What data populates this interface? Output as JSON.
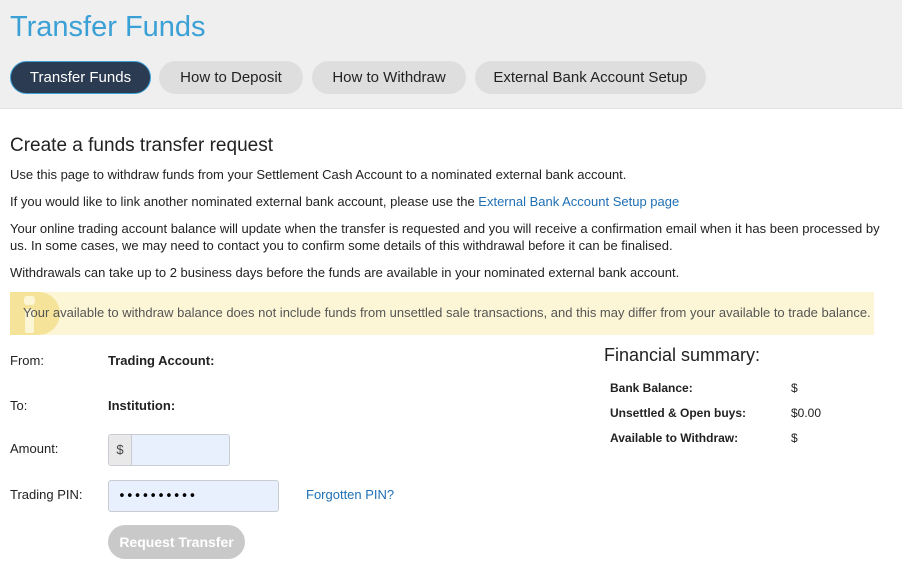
{
  "header": {
    "title": "Transfer Funds",
    "tabs": [
      {
        "label": "Transfer Funds",
        "active": true
      },
      {
        "label": "How to Deposit",
        "active": false
      },
      {
        "label": "How to Withdraw",
        "active": false
      },
      {
        "label": "External Bank Account Setup",
        "active": false
      }
    ]
  },
  "main": {
    "section_title": "Create a funds transfer request",
    "intro": "Use this page to withdraw funds from your Settlement Cash Account to a nominated external bank account.",
    "link_prefix": "If you would like to link another nominated external bank account, please use the ",
    "link_text": "External Bank Account Setup page",
    "balance_note": "Your online trading account balance will update when the transfer is requested and you will receive a confirmation email when it has been processed by us. In some cases, we may need to contact you to confirm some details of this withdrawal before it can be finalised.",
    "timing_note": "Withdrawals can take up to 2 business days before the funds are available in your nominated external bank account.",
    "notice": {
      "icon": "info-icon",
      "text": "Your available to withdraw balance does not include funds from unsettled sale transactions, and this may differ from your available to trade balance."
    }
  },
  "form": {
    "from_label": "From:",
    "from_value": "Trading Account:",
    "to_label": "To:",
    "to_value": "Institution:",
    "amount_label": "Amount:",
    "amount_prefix": "$",
    "amount_value": "",
    "pin_label": "Trading PIN:",
    "pin_value": "••••••••••",
    "forgot_pin": "Forgotten PIN?",
    "submit_label": "Request Transfer"
  },
  "summary": {
    "title": "Financial summary:",
    "rows": [
      {
        "label": "Bank Balance:",
        "value": "$"
      },
      {
        "label": "Unsettled & Open buys:",
        "value": "$0.00"
      },
      {
        "label": "Available to Withdraw:",
        "value": "$"
      }
    ]
  },
  "colors": {
    "title_blue": "#3ba0d6",
    "active_tab": "#2b3b52",
    "link_blue": "#1f6fb5",
    "notice_bg": "#fdf6d6",
    "input_bg": "#e8f0fd",
    "disabled_button": "#c9c9c9"
  }
}
